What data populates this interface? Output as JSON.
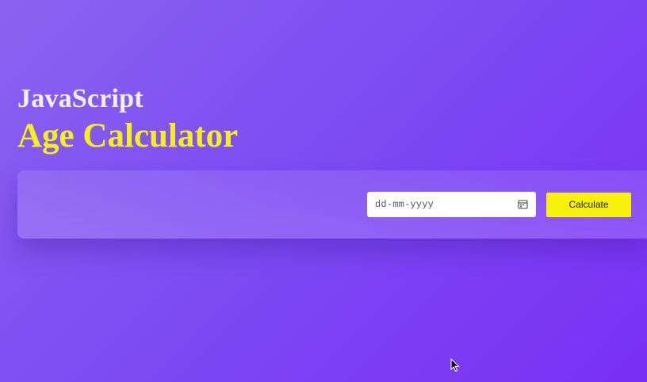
{
  "header": {
    "line1": "JavaScript",
    "line2": "Age Calculator"
  },
  "form": {
    "date_placeholder": "dd-mm-yyyy",
    "calculate_label": "Calculate"
  },
  "icons": {
    "calendar": "calendar-icon",
    "cursor": "mouse-pointer-icon"
  },
  "colors": {
    "accent": "#f8f20b",
    "background_start": "#8a63f0",
    "background_end": "#7a2ff5"
  }
}
